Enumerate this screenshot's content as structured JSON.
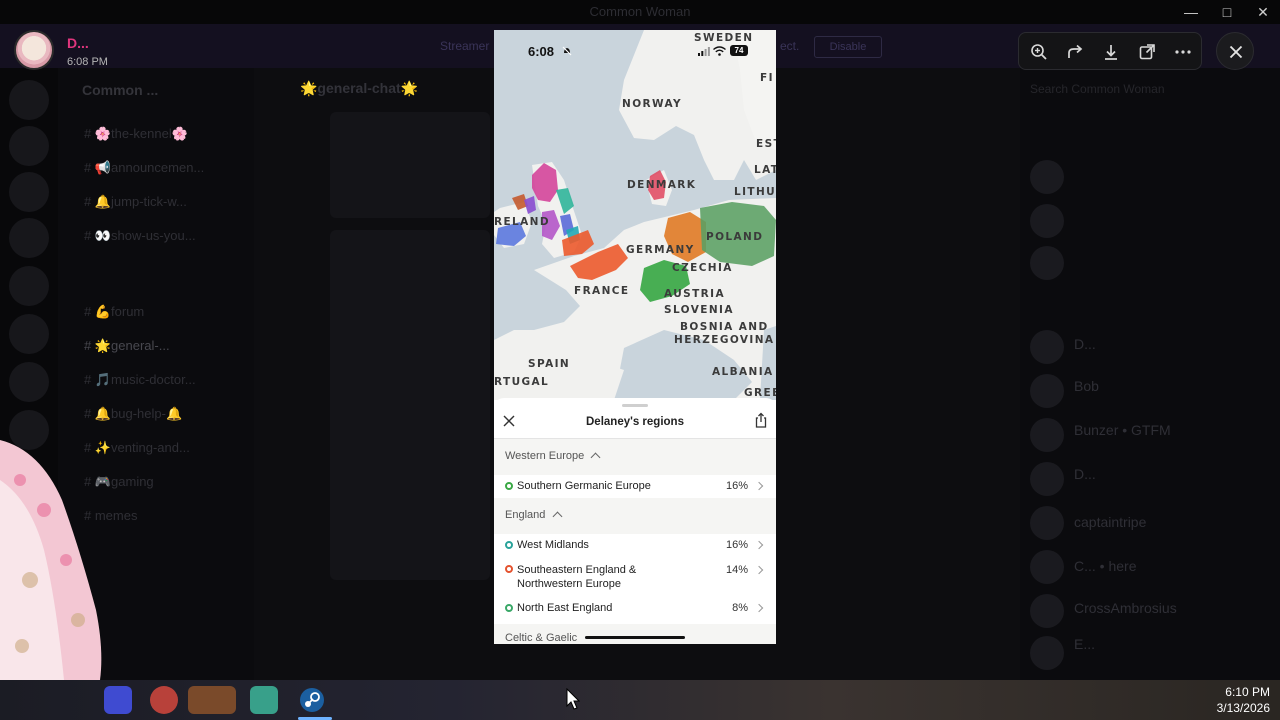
{
  "window": {
    "title": "Common Woman",
    "controls": [
      "—",
      "□",
      "✕"
    ]
  },
  "banner": {
    "text_left": "Streamer",
    "text_right": "ect.",
    "button": "Disable"
  },
  "discord": {
    "server_name": "Common ...",
    "channels": [
      {
        "label": "#  🌸the-kennel🌸"
      },
      {
        "label": "#  📢announcemen..."
      },
      {
        "label": "#  🔔jump-tick-w..."
      },
      {
        "label": "#  👀show-us-you..."
      },
      {
        "label": "#  💪forum"
      },
      {
        "label": "#  🌟general-..."
      },
      {
        "label": "#  🎵music-doctor..."
      },
      {
        "label": "#  🔔bug-help-🔔"
      },
      {
        "label": "#  ✨venting-and..."
      },
      {
        "label": "#  🎮gaming"
      },
      {
        "label": "#  memes"
      }
    ],
    "chat_header": "🌟general-chat🌟",
    "member_search": "Search Common Woman",
    "members": [
      "D...",
      "Bob",
      "Bunzer • GTFM",
      "D...",
      "captaintripe",
      "C... • here",
      "CrossAmbrosius",
      "E..."
    ]
  },
  "viewer": {
    "user_name": "D...",
    "timestamp": "6:08 PM",
    "toolbar_icons": [
      "zoom-in-icon",
      "forward-icon",
      "download-icon",
      "open-external-icon",
      "more-icon"
    ],
    "close_icon": "close-icon"
  },
  "phone": {
    "status_time": "6:08",
    "battery": "74",
    "map_labels": {
      "sweden": "SWEDEN",
      "finland": "FI",
      "norway": "NORWAY",
      "estonia": "EST",
      "latvia": "LAT",
      "lithuania": "LITHU",
      "denmark": "DENMARK",
      "ireland": "RELAND",
      "germany": "GERMANY",
      "poland": "POLAND",
      "czechia": "CZECHIA",
      "france": "FRANCE",
      "austria": "AUSTRIA",
      "slovenia": "SLOVENIA",
      "bosnia1": "BOSNIA AND",
      "bosnia2": "HERZEGOVINA",
      "spain": "SPAIN",
      "portugal": "RTUGAL",
      "albania": "ALBANIA",
      "greece": "GREE"
    },
    "sheet_title": "Delaney's regions",
    "sections": [
      {
        "name": "Western Europe",
        "rows": [
          {
            "label": "Southern Germanic Europe",
            "pct": "16%",
            "dot_color": "#3aa845"
          }
        ]
      },
      {
        "name": "England",
        "rows": [
          {
            "label": "West Midlands",
            "pct": "16%",
            "dot_color": "#2aa39a"
          },
          {
            "label": "Southeastern England & Northwestern Europe",
            "pct": "14%",
            "dot_color": "#e4532f"
          },
          {
            "label": "North East England",
            "pct": "8%",
            "dot_color": "#3aa868"
          }
        ]
      },
      {
        "name": "Celtic & Gaelic",
        "rows": []
      }
    ]
  },
  "taskbar": {
    "time": "6:10 PM",
    "date": "3/13/2026",
    "apps": [
      "discord-app",
      "chrome-app",
      "app-3",
      "files-app",
      "terminal-app",
      "steam-app"
    ]
  }
}
